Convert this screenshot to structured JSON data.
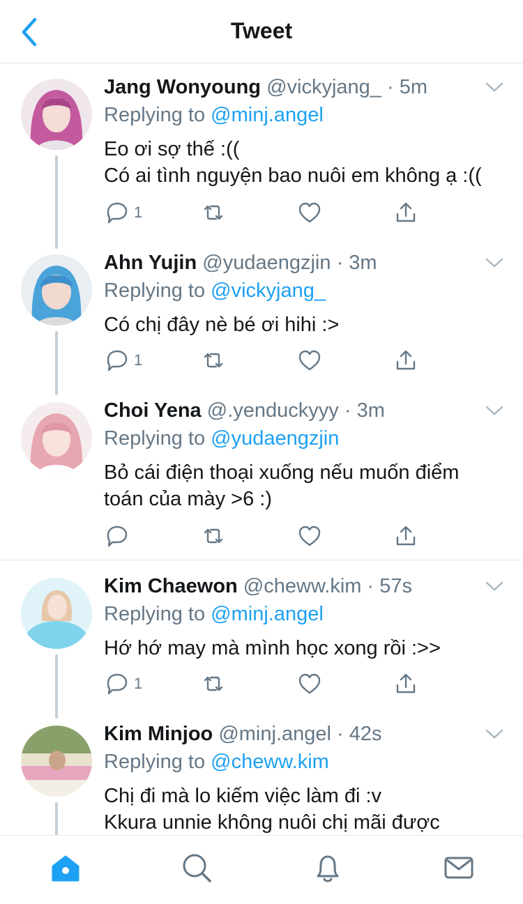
{
  "header": {
    "title": "Tweet"
  },
  "tweets": [
    {
      "name": "Jang Wonyoung",
      "handle": "@vickyjang_",
      "time": "5m",
      "replying_prefix": "Replying to",
      "replying_to": "@minj.angel",
      "text": [
        "Eo ơi sợ thế :((",
        "Có ai tình nguyện bao nuôi em không ạ :(("
      ],
      "reply_count": "1"
    },
    {
      "name": "Ahn Yujin",
      "handle": "@yudaengzjin",
      "time": "3m",
      "replying_prefix": "Replying to",
      "replying_to": "@vickyjang_",
      "text": [
        "Có chị đây nè bé ơi hihi :>"
      ],
      "reply_count": "1"
    },
    {
      "name": "Choi Yena",
      "handle": "@.yenduckyyy",
      "time": "3m",
      "replying_prefix": "Replying to",
      "replying_to": "@yudaengzjin",
      "text": [
        "Bỏ cái điện thoại xuống nếu muốn điểm",
        "toán của mày >6 :)"
      ],
      "reply_count": ""
    },
    {
      "name": "Kim Chaewon",
      "handle": "@cheww.kim",
      "time": "57s",
      "replying_prefix": "Replying to",
      "replying_to": "@minj.angel",
      "text": [
        "Hớ hớ may mà mình học xong rồi :>>"
      ],
      "reply_count": "1"
    },
    {
      "name": "Kim Minjoo",
      "handle": "@minj.angel",
      "time": "42s",
      "replying_prefix": "Replying to",
      "replying_to": "@cheww.kim",
      "text": [
        "Chị đi mà lo kiếm việc làm đi :v",
        "Kkura unnie không nuôi chị mãi được"
      ],
      "reply_count": ""
    }
  ],
  "separator": "·",
  "tabbar": {
    "items": [
      "home-icon",
      "search-icon",
      "notifications-icon",
      "messages-icon"
    ]
  },
  "colors": {
    "accent": "#1da1f2",
    "secondary": "#657786",
    "text": "#14171a"
  }
}
